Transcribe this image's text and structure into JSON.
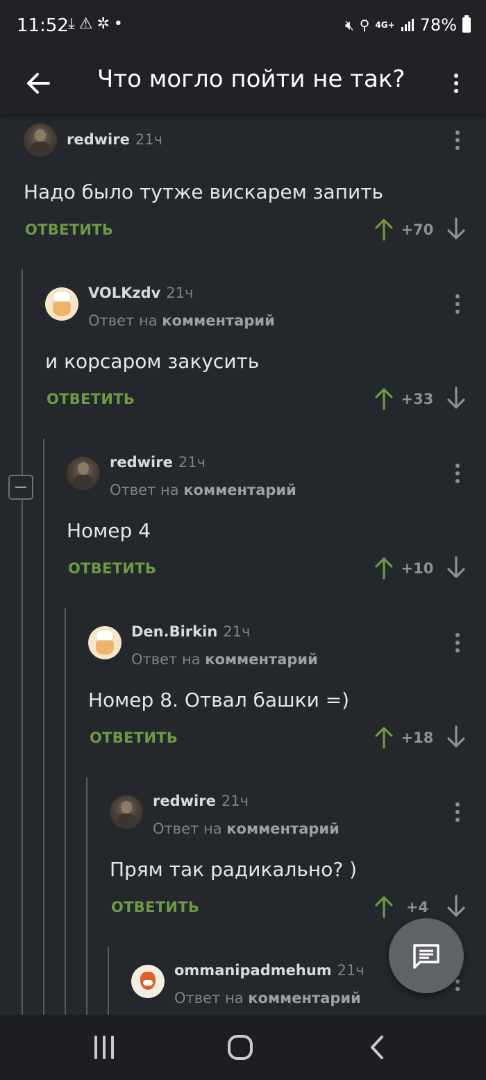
{
  "status_bar": {
    "time": "11:52",
    "left_icons": [
      "download-icon",
      "warning-icon",
      "sparkle-icon",
      "dot-icon"
    ],
    "right_icons": [
      "mute-icon",
      "location-icon",
      "4g-icon",
      "signal-icon"
    ],
    "network": "4G+",
    "battery": "78%"
  },
  "header": {
    "title": "Что могло пойти не так?",
    "back_icon": "arrow-left-icon",
    "menu_icon": "more-vertical-icon"
  },
  "comments": [
    {
      "author": "redwire",
      "time": "21ч",
      "reply_to": null,
      "text": "Надо было тутже вискарем запить",
      "reply_label": "ОТВЕТИТЬ",
      "score": "+70",
      "avatar": "photo"
    },
    {
      "author": "VOLKzdv",
      "time": "21ч",
      "reply_to_prefix": "Ответ на",
      "reply_to": "комментарий",
      "text": "и корсаром закусить",
      "reply_label": "ОТВЕТИТЬ",
      "score": "+33",
      "avatar": "chef"
    },
    {
      "author": "redwire",
      "time": "21ч",
      "reply_to_prefix": "Ответ на",
      "reply_to": "комментарий",
      "text": "Номер 4",
      "reply_label": "ОТВЕТИТЬ",
      "score": "+10",
      "avatar": "photo"
    },
    {
      "author": "Den.Birkin",
      "time": "21ч",
      "reply_to_prefix": "Ответ на",
      "reply_to": "комментарий",
      "text": "Номер 8. Отвал башки =)",
      "reply_label": "ОТВЕТИТЬ",
      "score": "+18",
      "avatar": "chef"
    },
    {
      "author": "redwire",
      "time": "21ч",
      "reply_to_prefix": "Ответ на",
      "reply_to": "комментарий",
      "text": "Прям так радикально? )",
      "reply_label": "ОТВЕТИТЬ",
      "score": "+4",
      "avatar": "photo"
    },
    {
      "author": "ommanipadmehum",
      "time": "21ч",
      "reply_to_prefix": "Ответ на",
      "reply_to": "комментарий",
      "avatar": "fox"
    }
  ],
  "fab": {
    "icon": "comment-icon"
  },
  "nav_bar": {
    "icons": [
      "recents-icon",
      "home-icon",
      "back-icon"
    ]
  },
  "colors": {
    "background": "#24272b",
    "accent_reply": "#6e9a45",
    "upvote": "#6e9a45",
    "downvote": "#8e9195"
  }
}
